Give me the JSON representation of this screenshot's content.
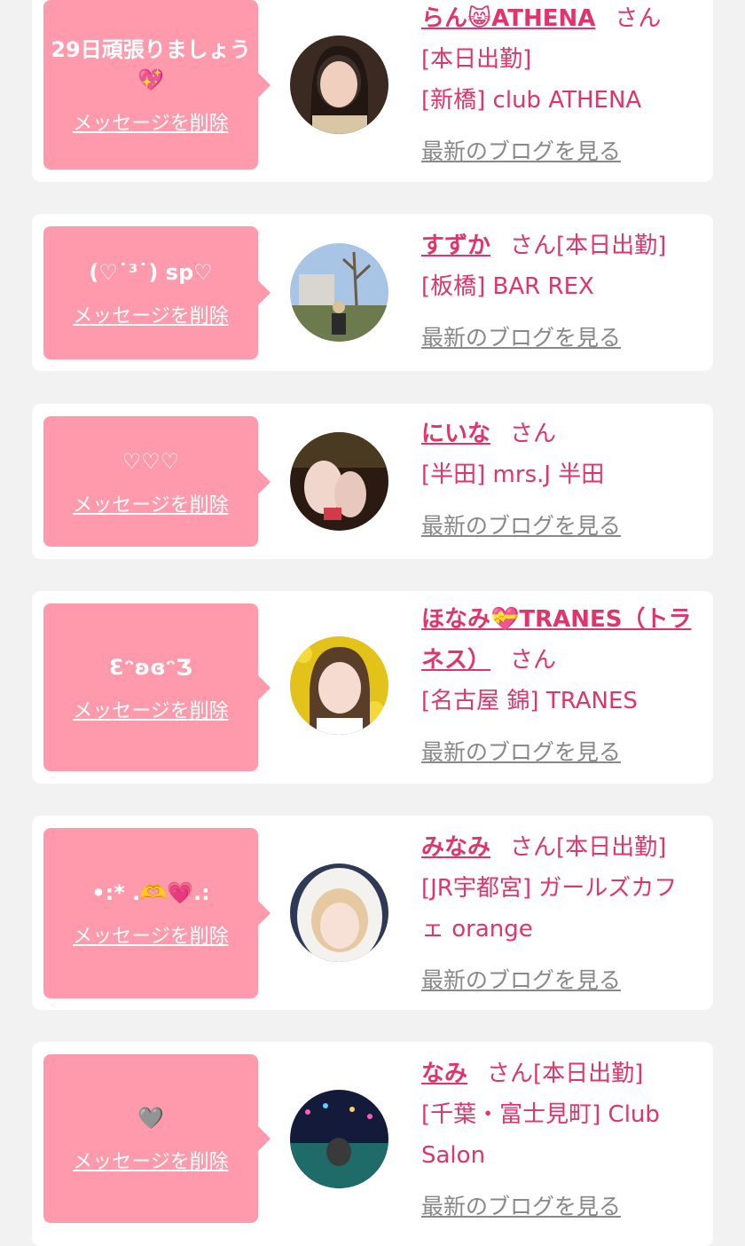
{
  "cards": [
    {
      "message": "29日頑張りましょう💖",
      "delete_label": "メッセージを削除",
      "name": "らん😸ATHENA",
      "honorific": "さん",
      "lines": [
        "[本日出勤]",
        "[新橋] club ATHENA"
      ],
      "blog_label": "最新のブログを見る"
    },
    {
      "message": "(♡˙³˙) sp♡",
      "delete_label": "メッセージを削除",
      "name": "すずか",
      "honorific": "さん[本日出勤]",
      "lines": [
        "[板橋] BAR REX"
      ],
      "blog_label": "最新のブログを見る"
    },
    {
      "message": "♡♡♡",
      "delete_label": "メッセージを削除",
      "name": "にいな",
      "honorific": "さん",
      "lines": [
        "[半田] mrs.J 半田"
      ],
      "blog_label": "最新のブログを見る"
    },
    {
      "message": "ƐᵔʚɞᵔƷ",
      "delete_label": "メッセージを削除",
      "name": "ほなみ💝TRANES（トラネス）",
      "honorific": "さん",
      "lines": [
        "[名古屋 錦] TRANES"
      ],
      "blog_label": "最新のブログを見る"
    },
    {
      "message": "•:* .🫶💗.:",
      "delete_label": "メッセージを削除",
      "name": "みなみ",
      "honorific": "さん[本日出勤]",
      "lines": [
        "[JR宇都宮] ガールズカフェ orange"
      ],
      "blog_label": "最新のブログを見る"
    },
    {
      "message": "🩶",
      "delete_label": "メッセージを削除",
      "name": "なみ",
      "honorific": "さん[本日出勤]",
      "lines": [
        "[千葉・富士見町] Club Salon"
      ],
      "blog_label": "最新のブログを見る"
    }
  ]
}
